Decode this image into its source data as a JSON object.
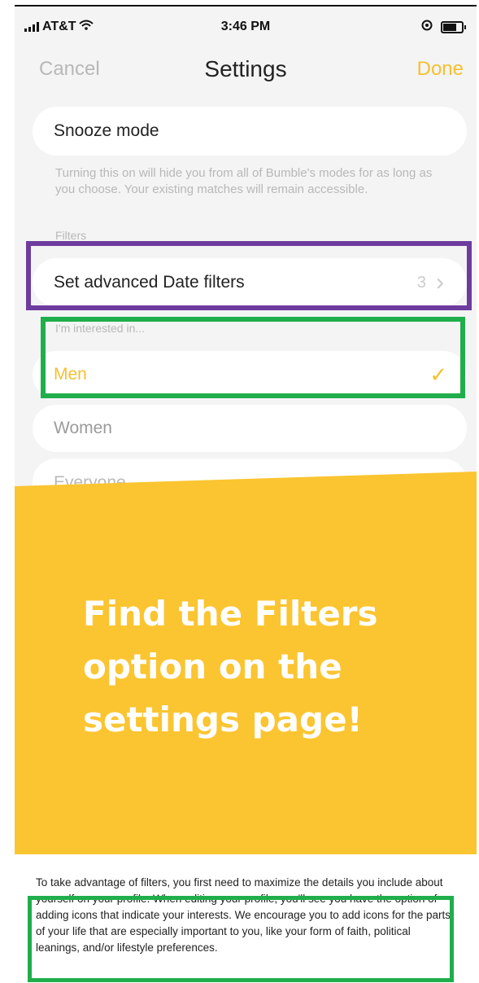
{
  "status_bar": {
    "carrier": "AT&T",
    "time": "3:46 PM",
    "battery_level": 0.8
  },
  "nav": {
    "cancel_label": "Cancel",
    "title": "Settings",
    "done_label": "Done"
  },
  "settings": {
    "snooze_label": "Snooze mode",
    "snooze_help": "Turning this on will hide you from all of Bumble's modes for as long as you choose. Your existing matches will remain accessible.",
    "filters_section_label": "Filters",
    "date_filters_label": "Set advanced Date filters",
    "date_filters_count": "3",
    "interested_label": "I'm interested in...",
    "options": [
      {
        "label": "Men",
        "selected": true
      },
      {
        "label": "Women",
        "selected": false
      },
      {
        "label": "Everyone",
        "selected": false
      }
    ]
  },
  "panel": {
    "heading": "Find the Filters option on the settings page!"
  },
  "article": {
    "paragraph": "To take advantage of filters, you first need to maximize the details you include about yourself on your profile. When editing your profile, you'll see you have the option of adding icons that indicate your interests. We encourage you to add icons for the parts of your life that are especially important to you, like your form of faith, political leanings, and/or lifestyle preferences."
  },
  "colors": {
    "accent_yellow": "#fbc531",
    "highlight_purple": "#6e3b9e",
    "highlight_green": "#1fae4b"
  }
}
